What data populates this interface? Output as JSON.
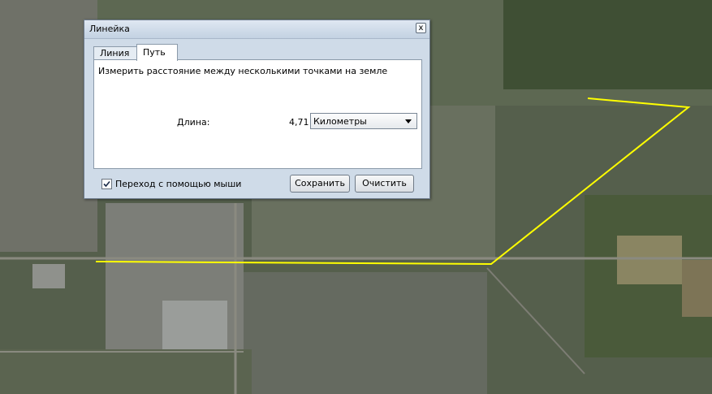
{
  "dialog": {
    "title": "Линейка",
    "close_glyph": "x",
    "tabs": [
      {
        "label": "Линия",
        "active": false
      },
      {
        "label": "Путь",
        "active": true
      }
    ],
    "description": "Измерить расстояние между несколькими точками на земле",
    "length_label": "Длина:",
    "length_value": "4,71",
    "unit_selected": "Километры",
    "mouse_nav_label": "Переход с помощью мыши",
    "mouse_nav_checked": true,
    "save_label": "Сохранить",
    "clear_label": "Очистить"
  },
  "map": {
    "path_color": "#ffff00"
  }
}
